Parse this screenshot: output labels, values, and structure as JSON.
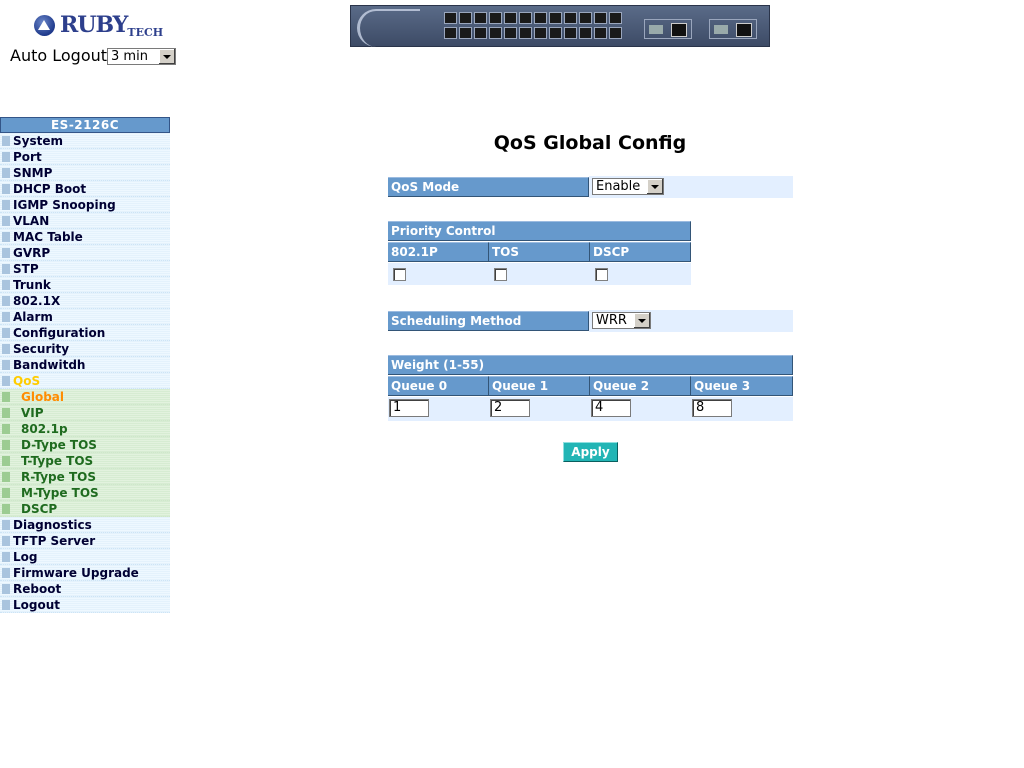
{
  "header": {
    "logo_text": "RUBY",
    "logo_suffix": "TECH",
    "auto_logout_label": "Auto Logout",
    "auto_logout_value": "3 min",
    "device_image": "switch-front-panel"
  },
  "sidebar": {
    "title": "ES-2126C",
    "items": [
      {
        "label": "System"
      },
      {
        "label": "Port"
      },
      {
        "label": "SNMP"
      },
      {
        "label": "DHCP Boot"
      },
      {
        "label": "IGMP Snooping"
      },
      {
        "label": "VLAN"
      },
      {
        "label": "MAC Table"
      },
      {
        "label": "GVRP"
      },
      {
        "label": "STP"
      },
      {
        "label": "Trunk"
      },
      {
        "label": "802.1X"
      },
      {
        "label": "Alarm"
      },
      {
        "label": "Configuration"
      },
      {
        "label": "Security"
      },
      {
        "label": "Bandwitdh"
      },
      {
        "label": "QoS"
      },
      {
        "label": "Global"
      },
      {
        "label": "VIP"
      },
      {
        "label": "802.1p"
      },
      {
        "label": "D-Type TOS"
      },
      {
        "label": "T-Type TOS"
      },
      {
        "label": "R-Type TOS"
      },
      {
        "label": "M-Type TOS"
      },
      {
        "label": "DSCP"
      },
      {
        "label": "Diagnostics"
      },
      {
        "label": "TFTP Server"
      },
      {
        "label": "Log"
      },
      {
        "label": "Firmware Upgrade"
      },
      {
        "label": "Reboot"
      },
      {
        "label": "Logout"
      }
    ]
  },
  "main": {
    "title": "QoS Global Config",
    "qos_mode": {
      "label": "QoS Mode",
      "value": "Enable"
    },
    "priority_control": {
      "title": "Priority Control",
      "columns": [
        "802.1P",
        "TOS",
        "DSCP"
      ],
      "checked": [
        false,
        false,
        false
      ]
    },
    "scheduling": {
      "label": "Scheduling Method",
      "value": "WRR"
    },
    "weight": {
      "title": "Weight (1-55)",
      "columns": [
        "Queue 0",
        "Queue 1",
        "Queue 2",
        "Queue 3"
      ],
      "values": [
        "1",
        "2",
        "4",
        "8"
      ]
    },
    "apply_label": "Apply"
  },
  "colors": {
    "header_blue": "#6699cc",
    "cell_bg": "#e3efff",
    "active_menu": "#ffcc00",
    "current_submenu": "#ff8c00",
    "apply_button": "#22b5b5"
  }
}
